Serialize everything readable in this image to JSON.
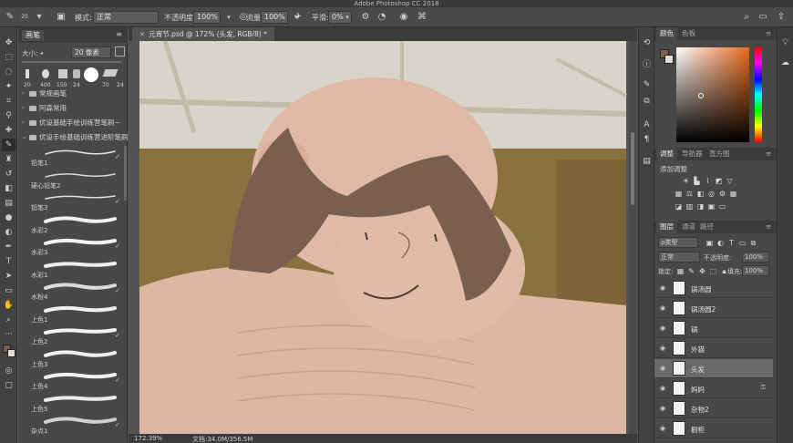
{
  "app": {
    "title": "Adobe Photoshop CC 2018"
  },
  "options_bar": {
    "mode_label": "模式:",
    "mode_value": "正常",
    "opacity_label": "不透明度:",
    "opacity_value": "100%",
    "flow_label": "流量:",
    "flow_value": "100%",
    "smoothing_label": "平滑:",
    "smoothing_value": "0%",
    "brush_size_badge": "20"
  },
  "brush_panel": {
    "tab": "画笔",
    "size_label": "大小:",
    "size_value": "20 像素",
    "presets": [
      {
        "label": "20"
      },
      {
        "label": "400"
      },
      {
        "label": "150"
      },
      {
        "label": "24"
      },
      {
        "label": "70"
      },
      {
        "label": "24"
      }
    ],
    "folders": [
      {
        "label": "常规画笔"
      },
      {
        "label": "阿森常用"
      },
      {
        "label": "优设基础手绘训练营笔刷~"
      },
      {
        "label": "优设手绘基础训练营进阶笔刷"
      }
    ],
    "brushes": [
      {
        "label": "铅笔1"
      },
      {
        "label": "硬心铅笔2"
      },
      {
        "label": "铅笔3"
      },
      {
        "label": "水彩2"
      },
      {
        "label": "水彩3"
      },
      {
        "label": "水彩1"
      },
      {
        "label": "水粉4"
      },
      {
        "label": "上色1"
      },
      {
        "label": "上色2"
      },
      {
        "label": "上色3"
      },
      {
        "label": "上色4"
      },
      {
        "label": "上色5"
      },
      {
        "label": "杂点1"
      }
    ]
  },
  "document": {
    "tab_label": "元宵节.psd @ 172% (头发, RGB/8) *"
  },
  "color_panel": {
    "tabs": [
      "颜色",
      "色板"
    ]
  },
  "adjustments_panel": {
    "tabs": [
      "调整",
      "导航器",
      "直方图"
    ],
    "title": "添加调整"
  },
  "layers_panel": {
    "tabs": [
      "图层",
      "通道",
      "路径"
    ],
    "filter_label": "ρ类型",
    "blend_mode": "正常",
    "opacity_label": "不透明度:",
    "opacity_value": "100%",
    "lock_label": "锁定:",
    "fill_label": "填充:",
    "fill_value": "100%",
    "layers": [
      {
        "name": "锅汤圆"
      },
      {
        "name": "锅汤圆2"
      },
      {
        "name": "锅"
      },
      {
        "name": "外猫"
      },
      {
        "name": "头发"
      },
      {
        "name": "妈妈"
      },
      {
        "name": "杂物2"
      },
      {
        "name": "橱柜"
      }
    ]
  },
  "status_bar": {
    "zoom": "172.39%",
    "doc_size": "文档:34.0M/356.5M"
  },
  "colors": {
    "foreground": "#7a5f50",
    "background": "#e8dcd0",
    "hue_marker": "#e86a1c"
  },
  "icons": [
    "brush-icon",
    "move-icon",
    "marquee-icon",
    "lasso-icon",
    "crop-icon",
    "eyedropper-icon",
    "healing-icon",
    "eraser-icon",
    "gradient-icon",
    "pen-icon",
    "type-icon",
    "hand-icon",
    "zoom-icon",
    "search-icon",
    "workspace-icon",
    "share-icon"
  ]
}
